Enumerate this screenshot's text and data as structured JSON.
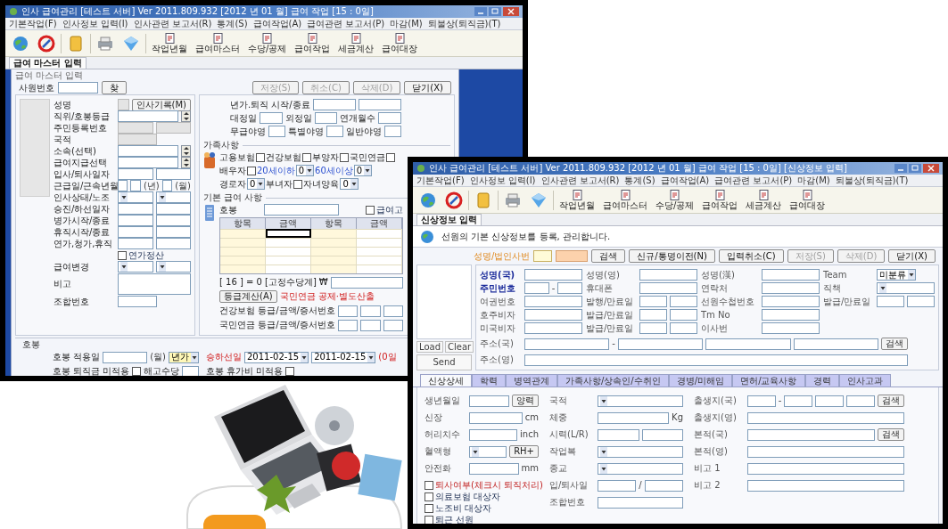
{
  "payroll": {
    "title": "인사 급여관리  [테스트 서버]  Ver 2011.809.932  [2012 년 01 월] 급여 작업  [15 : 0일]",
    "menu": [
      "기본작업(F)",
      "인사정보 입력(I)",
      "인사관련 보고서(R)",
      "통계(S)",
      "급여작업(A)",
      "급여관련 보고서(P)",
      "마감(M)",
      "퇴불상(퇴직금)(T)"
    ],
    "tools": [
      "작업년월",
      "급여마스터",
      "수당/공제",
      "급여작업",
      "세금계산",
      "급여대장"
    ],
    "tab": "급여 마스터 입력",
    "dialog": {
      "title": "급여 마스터 입력",
      "employee_label": "사원번호",
      "find_button": "찾",
      "buttons": [
        {
          "label": "저장(S)",
          "disabled": true
        },
        {
          "label": "취소(C)",
          "disabled": true
        },
        {
          "label": "삭제(D)",
          "disabled": true
        },
        {
          "label": "닫기(X)",
          "disabled": false
        }
      ],
      "left_rows": [
        {
          "label": "성명",
          "controls": [
            {
              "kind": "readonly"
            },
            {
              "kind": "button",
              "label": "인사기록(M)"
            }
          ]
        },
        {
          "label": "직위/호봉등급",
          "controls": [
            {
              "kind": "text"
            },
            {
              "kind": "spin"
            }
          ]
        },
        {
          "label": "주민등록번호",
          "controls": [
            {
              "kind": "readonly"
            },
            {
              "kind": "readonly"
            }
          ]
        },
        {
          "label": "국적",
          "controls": [
            {
              "kind": "readonly"
            }
          ]
        },
        {
          "label": "소속(선택)",
          "controls": [
            {
              "kind": "text"
            },
            {
              "kind": "spin"
            }
          ]
        },
        {
          "label": "급여지급선택",
          "controls": [
            {
              "kind": "text"
            },
            {
              "kind": "spin"
            }
          ]
        },
        {
          "label": "입사/퇴사일자",
          "controls": [
            {
              "kind": "text"
            },
            {
              "kind": "text"
            }
          ]
        },
        {
          "label": "근급일/근속년월",
          "controls": [
            {
              "kind": "text"
            },
            {
              "kind": "text"
            },
            {
              "kind": "unit",
              "text": "(년)"
            },
            {
              "kind": "text"
            },
            {
              "kind": "unit",
              "text": "(월)"
            }
          ]
        },
        {
          "label": "인사상태/노조",
          "controls": [
            {
              "kind": "select"
            },
            {
              "kind": "select"
            }
          ]
        },
        {
          "label": "승진/하선일자",
          "controls": [
            {
              "kind": "text"
            },
            {
              "kind": "text"
            }
          ]
        },
        {
          "label": "병가시작/종료",
          "controls": [
            {
              "kind": "text"
            },
            {
              "kind": "text"
            }
          ]
        },
        {
          "label": "휴직시작/종료",
          "controls": [
            {
              "kind": "text"
            },
            {
              "kind": "text"
            }
          ]
        },
        {
          "label": "연가,청가,휴직",
          "controls": [
            {
              "kind": "text"
            },
            {
              "kind": "text"
            }
          ]
        },
        {
          "controls": [
            {
              "kind": "check",
              "label": "연가정산",
              "checked": false
            }
          ]
        },
        {
          "label": "급여변경",
          "controls": [
            {
              "kind": "select"
            },
            {
              "kind": "select"
            }
          ]
        },
        {
          "label": "비고",
          "controls": [
            {
              "kind": "textarea"
            }
          ]
        },
        {
          "label": "조합번호",
          "controls": [
            {
              "kind": "text"
            }
          ]
        }
      ],
      "right_rows": [
        {
          "controls": [
            {
              "kind": "label",
              "text": "년가.퇴직 시작/종료"
            },
            {
              "kind": "text"
            },
            {
              "kind": "text"
            }
          ]
        },
        {
          "controls": [
            {
              "kind": "label",
              "text": "대정일"
            },
            {
              "kind": "text"
            },
            {
              "kind": "label",
              "text": "외정일"
            },
            {
              "kind": "text"
            },
            {
              "kind": "label",
              "text": "연개월수"
            },
            {
              "kind": "text"
            }
          ]
        },
        {
          "controls": [
            {
              "kind": "label",
              "text": "무급야영"
            },
            {
              "kind": "text"
            },
            {
              "kind": "label",
              "text": "특별야영"
            },
            {
              "kind": "text"
            },
            {
              "kind": "label",
              "text": "일반야영"
            },
            {
              "kind": "text"
            }
          ]
        }
      ],
      "family": {
        "title": "가족사항",
        "rows": [
          {
            "controls": [
              {
                "kind": "label",
                "text": "고용보험"
              },
              {
                "kind": "check",
                "checked": false
              },
              {
                "kind": "label",
                "text": "건강보험"
              },
              {
                "kind": "check",
                "checked": false
              },
              {
                "kind": "label",
                "text": "부양자"
              },
              {
                "kind": "check",
                "checked": false
              },
              {
                "kind": "label",
                "text": "국민연금"
              },
              {
                "kind": "check",
                "checked": false
              }
            ]
          },
          {
            "controls": [
              {
                "kind": "label",
                "text": "배우자"
              },
              {
                "kind": "check",
                "checked": false
              },
              {
                "kind": "accent",
                "text": "20세이하"
              },
              {
                "kind": "select",
                "value": "0"
              },
              {
                "kind": "accent",
                "text": "60세이상"
              },
              {
                "kind": "select",
                "value": "0"
              }
            ]
          },
          {
            "controls": [
              {
                "kind": "label",
                "text": "경로자"
              },
              {
                "kind": "select",
                "value": "0"
              },
              {
                "kind": "label",
                "text": "부녀자"
              },
              {
                "kind": "check",
                "checked": false
              },
              {
                "kind": "label",
                "text": "자녀양육"
              },
              {
                "kind": "select",
                "value": "0"
              }
            ]
          }
        ]
      },
      "pay": {
        "title": "기본 급여 사항",
        "top_rows": [
          {
            "controls": [
              {
                "kind": "label",
                "text": "호봉"
              },
              {
                "kind": "text"
              },
              {
                "kind": "check",
                "label": "급여고",
                "checked": false
              }
            ]
          }
        ],
        "table": {
          "columns": [
            "항목",
            "금액",
            "항목",
            "금액"
          ],
          "rows": [
            {
              "focus": true
            },
            {
              "focus": false
            },
            {
              "focus": false
            },
            {
              "focus": false
            },
            {
              "focus": false
            }
          ]
        },
        "rows": [
          {
            "controls": [
              {
                "kind": "label",
                "text": "[ 16 ] = 0"
              },
              {
                "kind": "label",
                "text": "[고정수당계]"
              },
              {
                "kind": "label",
                "text": "₩"
              },
              {
                "kind": "text"
              }
            ]
          },
          {
            "controls": [
              {
                "kind": "button",
                "label": "등급계산(A)"
              },
              {
                "kind": "warning",
                "text": "국민연금 공제·별도산출"
              }
            ]
          },
          {
            "controls": [
              {
                "kind": "label",
                "text": "건강보험 등급/금액/증서번호"
              },
              {
                "kind": "text"
              },
              {
                "kind": "text"
              },
              {
                "kind": "text"
              }
            ]
          },
          {
            "controls": [
              {
                "kind": "label",
                "text": "국민연금 등급/금액/증서번호"
              },
              {
                "kind": "text"
              },
              {
                "kind": "text"
              },
              {
                "kind": "text"
              }
            ]
          }
        ]
      },
      "bottom": {
        "title": "호봉",
        "rows": [
          {
            "left": [
              {
                "kind": "label",
                "text": "호봉 적용일"
              },
              {
                "kind": "text"
              },
              {
                "kind": "unit",
                "text": "(월)"
              },
              {
                "kind": "active_select",
                "value": "년가"
              }
            ],
            "right": [
              {
                "kind": "warning",
                "text": "승하선일"
              },
              {
                "kind": "select",
                "value": "2011-02-15"
              },
              {
                "kind": "select",
                "value": "2011-02-15"
              },
              {
                "kind": "warning",
                "text": "(0일"
              }
            ]
          },
          {
            "left": [
              {
                "kind": "label",
                "text": "호봉 퇴직금 미적용"
              },
              {
                "kind": "check",
                "checked": false
              },
              {
                "kind": "label",
                "text": "해고수당"
              },
              {
                "kind": "text"
              }
            ],
            "right": [
              {
                "kind": "label",
                "text": "호봉 휴가비 미적용"
              },
              {
                "kind": "check",
                "checked": false
              }
            ]
          }
        ]
      }
    }
  },
  "profile": {
    "title": "인사 급여관리  [테스트 서버]  Ver 2011.809.932  [2012 년 01 월] 급여 작업  [15 : 0일]  [신상정보 입력]",
    "menu": [
      "기본작업(F)",
      "인사정보 입력(I)",
      "인사관련 보고서(R)",
      "통계(S)",
      "급여작업(A)",
      "급여관련 보고서(P)",
      "마감(M)",
      "퇴불상(퇴직금)(T)"
    ],
    "tools": [
      "작업년월",
      "급여마스터",
      "수당/공제",
      "급여작업",
      "세금계산",
      "급여대장"
    ],
    "tab": "신상정보 입력",
    "info": "선원의 기본 신상정보를 등록, 관리합니다.",
    "search_label": "성명/법인사번",
    "buttons": [
      {
        "label": "검색",
        "disabled": false
      },
      {
        "label": "신규/통명이전(N)",
        "disabled": false
      },
      {
        "label": "입력취소(C)",
        "disabled": false
      },
      {
        "label": "저장(S)",
        "disabled": true
      },
      {
        "label": "삭제(D)",
        "disabled": true
      },
      {
        "label": "닫기(X)",
        "disabled": false
      }
    ],
    "photo_buttons": [
      "Load",
      "Clear",
      "Send"
    ],
    "grid": [
      [
        {
          "label": "성명(국)",
          "required": true,
          "controls": [
            {
              "kind": "text"
            }
          ]
        },
        {
          "label": "성명(영)",
          "required": false,
          "controls": [
            {
              "kind": "text"
            }
          ]
        },
        {
          "label": "성명(漢)",
          "required": false,
          "controls": [
            {
              "kind": "text"
            }
          ]
        },
        {
          "label": "Team",
          "required": false,
          "controls": [
            {
              "kind": "select",
              "value": "미분류"
            }
          ]
        }
      ],
      [
        {
          "label": "주민번호",
          "required": true,
          "controls": [
            {
              "kind": "text"
            },
            {
              "kind": "sep",
              "text": "-"
            },
            {
              "kind": "text"
            }
          ]
        },
        {
          "label": "휴대폰",
          "required": false,
          "controls": [
            {
              "kind": "text"
            }
          ]
        },
        {
          "label": "연락처",
          "required": false,
          "controls": [
            {
              "kind": "text"
            }
          ]
        },
        {
          "label": "직책",
          "required": false,
          "controls": [
            {
              "kind": "select"
            }
          ]
        }
      ],
      [
        {
          "label": "여권번호",
          "required": false,
          "controls": [
            {
              "kind": "text"
            }
          ]
        },
        {
          "label": "발행/만료일",
          "required": false,
          "controls": [
            {
              "kind": "text"
            },
            {
              "kind": "text"
            }
          ]
        },
        {
          "label": "선원수첩번호",
          "required": false,
          "controls": [
            {
              "kind": "text"
            }
          ]
        },
        {
          "label": "발급/만료일",
          "required": false,
          "controls": [
            {
              "kind": "text"
            },
            {
              "kind": "text"
            }
          ]
        }
      ],
      [
        {
          "label": "호주비자",
          "required": false,
          "controls": [
            {
              "kind": "text"
            }
          ]
        },
        {
          "label": "발급/만료일",
          "required": false,
          "controls": [
            {
              "kind": "text"
            },
            {
              "kind": "text"
            }
          ]
        },
        {
          "label": "Tm No",
          "required": false,
          "controls": [
            {
              "kind": "text"
            }
          ]
        }
      ],
      [
        {
          "label": "미국비자",
          "required": false,
          "controls": [
            {
              "kind": "text"
            }
          ]
        },
        {
          "label": "발급/만료일",
          "required": false,
          "controls": [
            {
              "kind": "text"
            },
            {
              "kind": "text"
            }
          ]
        },
        {
          "label": "이사번",
          "required": false,
          "controls": [
            {
              "kind": "text"
            }
          ]
        }
      ]
    ],
    "address": [
      {
        "label": "주소(국)",
        "controls": [
          {
            "kind": "text"
          },
          {
            "kind": "sep",
            "text": "-"
          },
          {
            "kind": "text"
          },
          {
            "kind": "text"
          },
          {
            "kind": "text"
          },
          {
            "kind": "button",
            "label": "검색"
          }
        ]
      },
      {
        "label": "주소(영)",
        "controls": [
          {
            "kind": "text"
          }
        ]
      }
    ],
    "tabs": [
      {
        "label": "신상상세",
        "selected": true
      },
      {
        "label": "학력",
        "selected": false
      },
      {
        "label": "병역관계",
        "selected": false
      },
      {
        "label": "가족사항/상속인/수취인",
        "selected": false
      },
      {
        "label": "경병/미해임",
        "selected": false
      },
      {
        "label": "면허/교육사항",
        "selected": false
      },
      {
        "label": "경력",
        "selected": false
      },
      {
        "label": "인사고과",
        "selected": false
      }
    ],
    "detail": [
      {
        "rows": [
          {
            "label": "생년월일",
            "controls": [
              {
                "kind": "text"
              },
              {
                "kind": "button",
                "label": "양력"
              }
            ]
          },
          {
            "label": "신장",
            "controls": [
              {
                "kind": "text"
              },
              {
                "kind": "unit",
                "text": "cm"
              }
            ]
          },
          {
            "label": "허리치수",
            "controls": [
              {
                "kind": "text"
              },
              {
                "kind": "unit",
                "text": "inch"
              }
            ]
          },
          {
            "label": "혈액형",
            "controls": [
              {
                "kind": "select"
              },
              {
                "kind": "button",
                "label": "RH+"
              }
            ]
          },
          {
            "label": "안전화",
            "controls": [
              {
                "kind": "text"
              },
              {
                "kind": "unit",
                "text": "mm"
              }
            ]
          }
        ],
        "checks": [
          {
            "kind": "alert_check",
            "label": "퇴사여부(체크시 퇴직처리)",
            "checked": false
          },
          {
            "kind": "check",
            "label": "의료보험 대상자",
            "checked": false
          },
          {
            "kind": "check",
            "label": "노조비 대상자",
            "checked": false
          },
          {
            "kind": "check",
            "label": "퇴근 선원",
            "checked": false
          }
        ]
      },
      {
        "rows": [
          {
            "label": "국적",
            "controls": [
              {
                "kind": "select"
              }
            ]
          },
          {
            "label": "체중",
            "controls": [
              {
                "kind": "text"
              },
              {
                "kind": "unit",
                "text": "Kg"
              }
            ]
          },
          {
            "label": "시력(L/R)",
            "controls": [
              {
                "kind": "text"
              },
              {
                "kind": "text"
              }
            ]
          },
          {
            "label": "작업복",
            "controls": [
              {
                "kind": "select"
              }
            ]
          },
          {
            "label": "종교",
            "controls": [
              {
                "kind": "select"
              }
            ]
          },
          {
            "label": "입/퇴사일",
            "controls": [
              {
                "kind": "text"
              },
              {
                "kind": "sep",
                "text": "/"
              },
              {
                "kind": "text"
              }
            ]
          },
          {
            "label": "조합번호",
            "controls": [
              {
                "kind": "text"
              }
            ]
          }
        ]
      },
      {
        "rows": [
          {
            "label": "출생지(국)",
            "controls": [
              {
                "kind": "text"
              },
              {
                "kind": "sep",
                "text": "-"
              },
              {
                "kind": "text"
              },
              {
                "kind": "text"
              },
              {
                "kind": "text"
              },
              {
                "kind": "button",
                "label": "검색"
              }
            ]
          },
          {
            "label": "출생지(영)",
            "controls": [
              {
                "kind": "text"
              }
            ]
          },
          {
            "label": "본적(국)",
            "controls": [
              {
                "kind": "text"
              },
              {
                "kind": "button",
                "label": "검색"
              }
            ]
          },
          {
            "label": "본적(영)",
            "controls": [
              {
                "kind": "text"
              }
            ]
          },
          {
            "label": "비고 1",
            "controls": [
              {
                "kind": "text"
              }
            ]
          },
          {
            "label": "비고 2",
            "controls": [
              {
                "kind": "text"
              }
            ]
          }
        ]
      }
    ]
  }
}
